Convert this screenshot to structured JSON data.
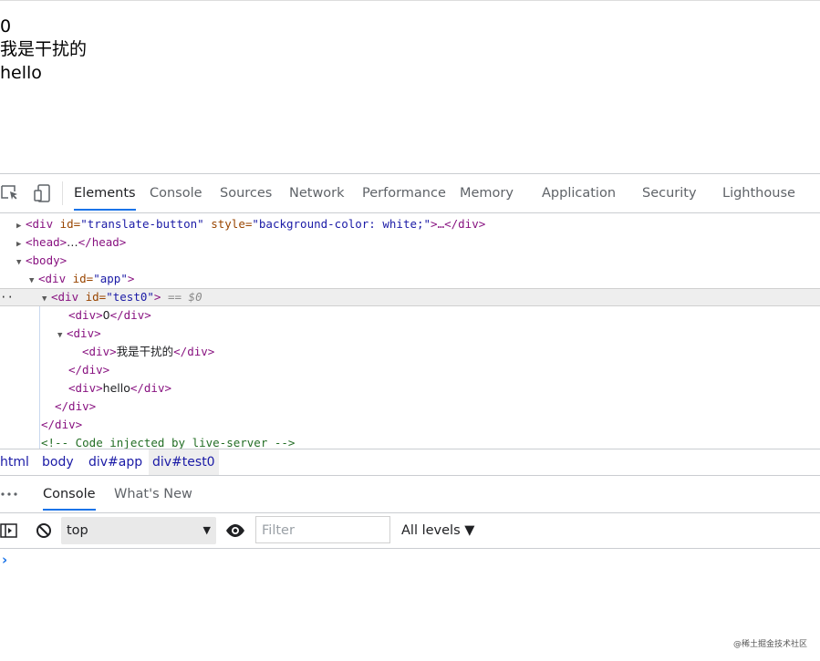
{
  "page": {
    "lines": [
      "0",
      "我是干扰的",
      "hello"
    ]
  },
  "devtools": {
    "tabs": [
      "Elements",
      "Console",
      "Sources",
      "Network",
      "Performance",
      "Memory",
      "Application",
      "Security",
      "Lighthouse"
    ],
    "active_tab": "Elements",
    "dom": {
      "rows": {
        "r0": {
          "tag": "<div",
          "a1n": " id=",
          "a1v": "\"translate-button\"",
          "a2n": " style=",
          "a2v": "\"background-color: white;\"",
          "rest": ">…</div>"
        },
        "r1": {
          "open": "<head>",
          "mid": "…",
          "close": "</head>"
        },
        "r2": {
          "open": "<body>"
        },
        "r3": {
          "tag": "<div",
          "a1n": " id=",
          "a1v": "\"app\"",
          "end": ">"
        },
        "r4": {
          "tag": "<div",
          "a1n": " id=",
          "a1v": "\"test0\"",
          "end": ">",
          "eq": " == $0",
          "dots": "··"
        },
        "r5": {
          "open": "<div>",
          "text": "0",
          "close": "</div>"
        },
        "r6": {
          "open": "<div>"
        },
        "r7": {
          "open": "<div>",
          "text": "我是干扰的",
          "close": "</div>"
        },
        "r8": {
          "close": "</div>"
        },
        "r9": {
          "open": "<div>",
          "text": "hello",
          "close": "</div>"
        },
        "r10": {
          "close": "</div>"
        },
        "r11": {
          "close": "</div>"
        },
        "r12": {
          "comment": "<!-- Code injected by live-server -->"
        }
      }
    },
    "breadcrumbs": [
      "html",
      "body",
      "div#app",
      "div#test0"
    ],
    "drawer": {
      "dots": "⋮",
      "tabs": [
        "Console",
        "What's New"
      ],
      "active_tab": "Console"
    },
    "console": {
      "context": "top",
      "filter_placeholder": "Filter",
      "levels": "All levels ▼",
      "prompt": "›"
    },
    "colors": {
      "accent": "#1a73e8",
      "tag": "#881280",
      "attr_name": "#994500",
      "attr_value": "#1a1aa6",
      "comment": "#236e25"
    },
    "icons": [
      "inspect-element-icon",
      "device-toolbar-icon",
      "sidebar-toggle-icon",
      "clear-console-icon",
      "eye-icon",
      "dropdown-arrow-icon"
    ]
  },
  "watermark": "@稀土掘金技术社区"
}
